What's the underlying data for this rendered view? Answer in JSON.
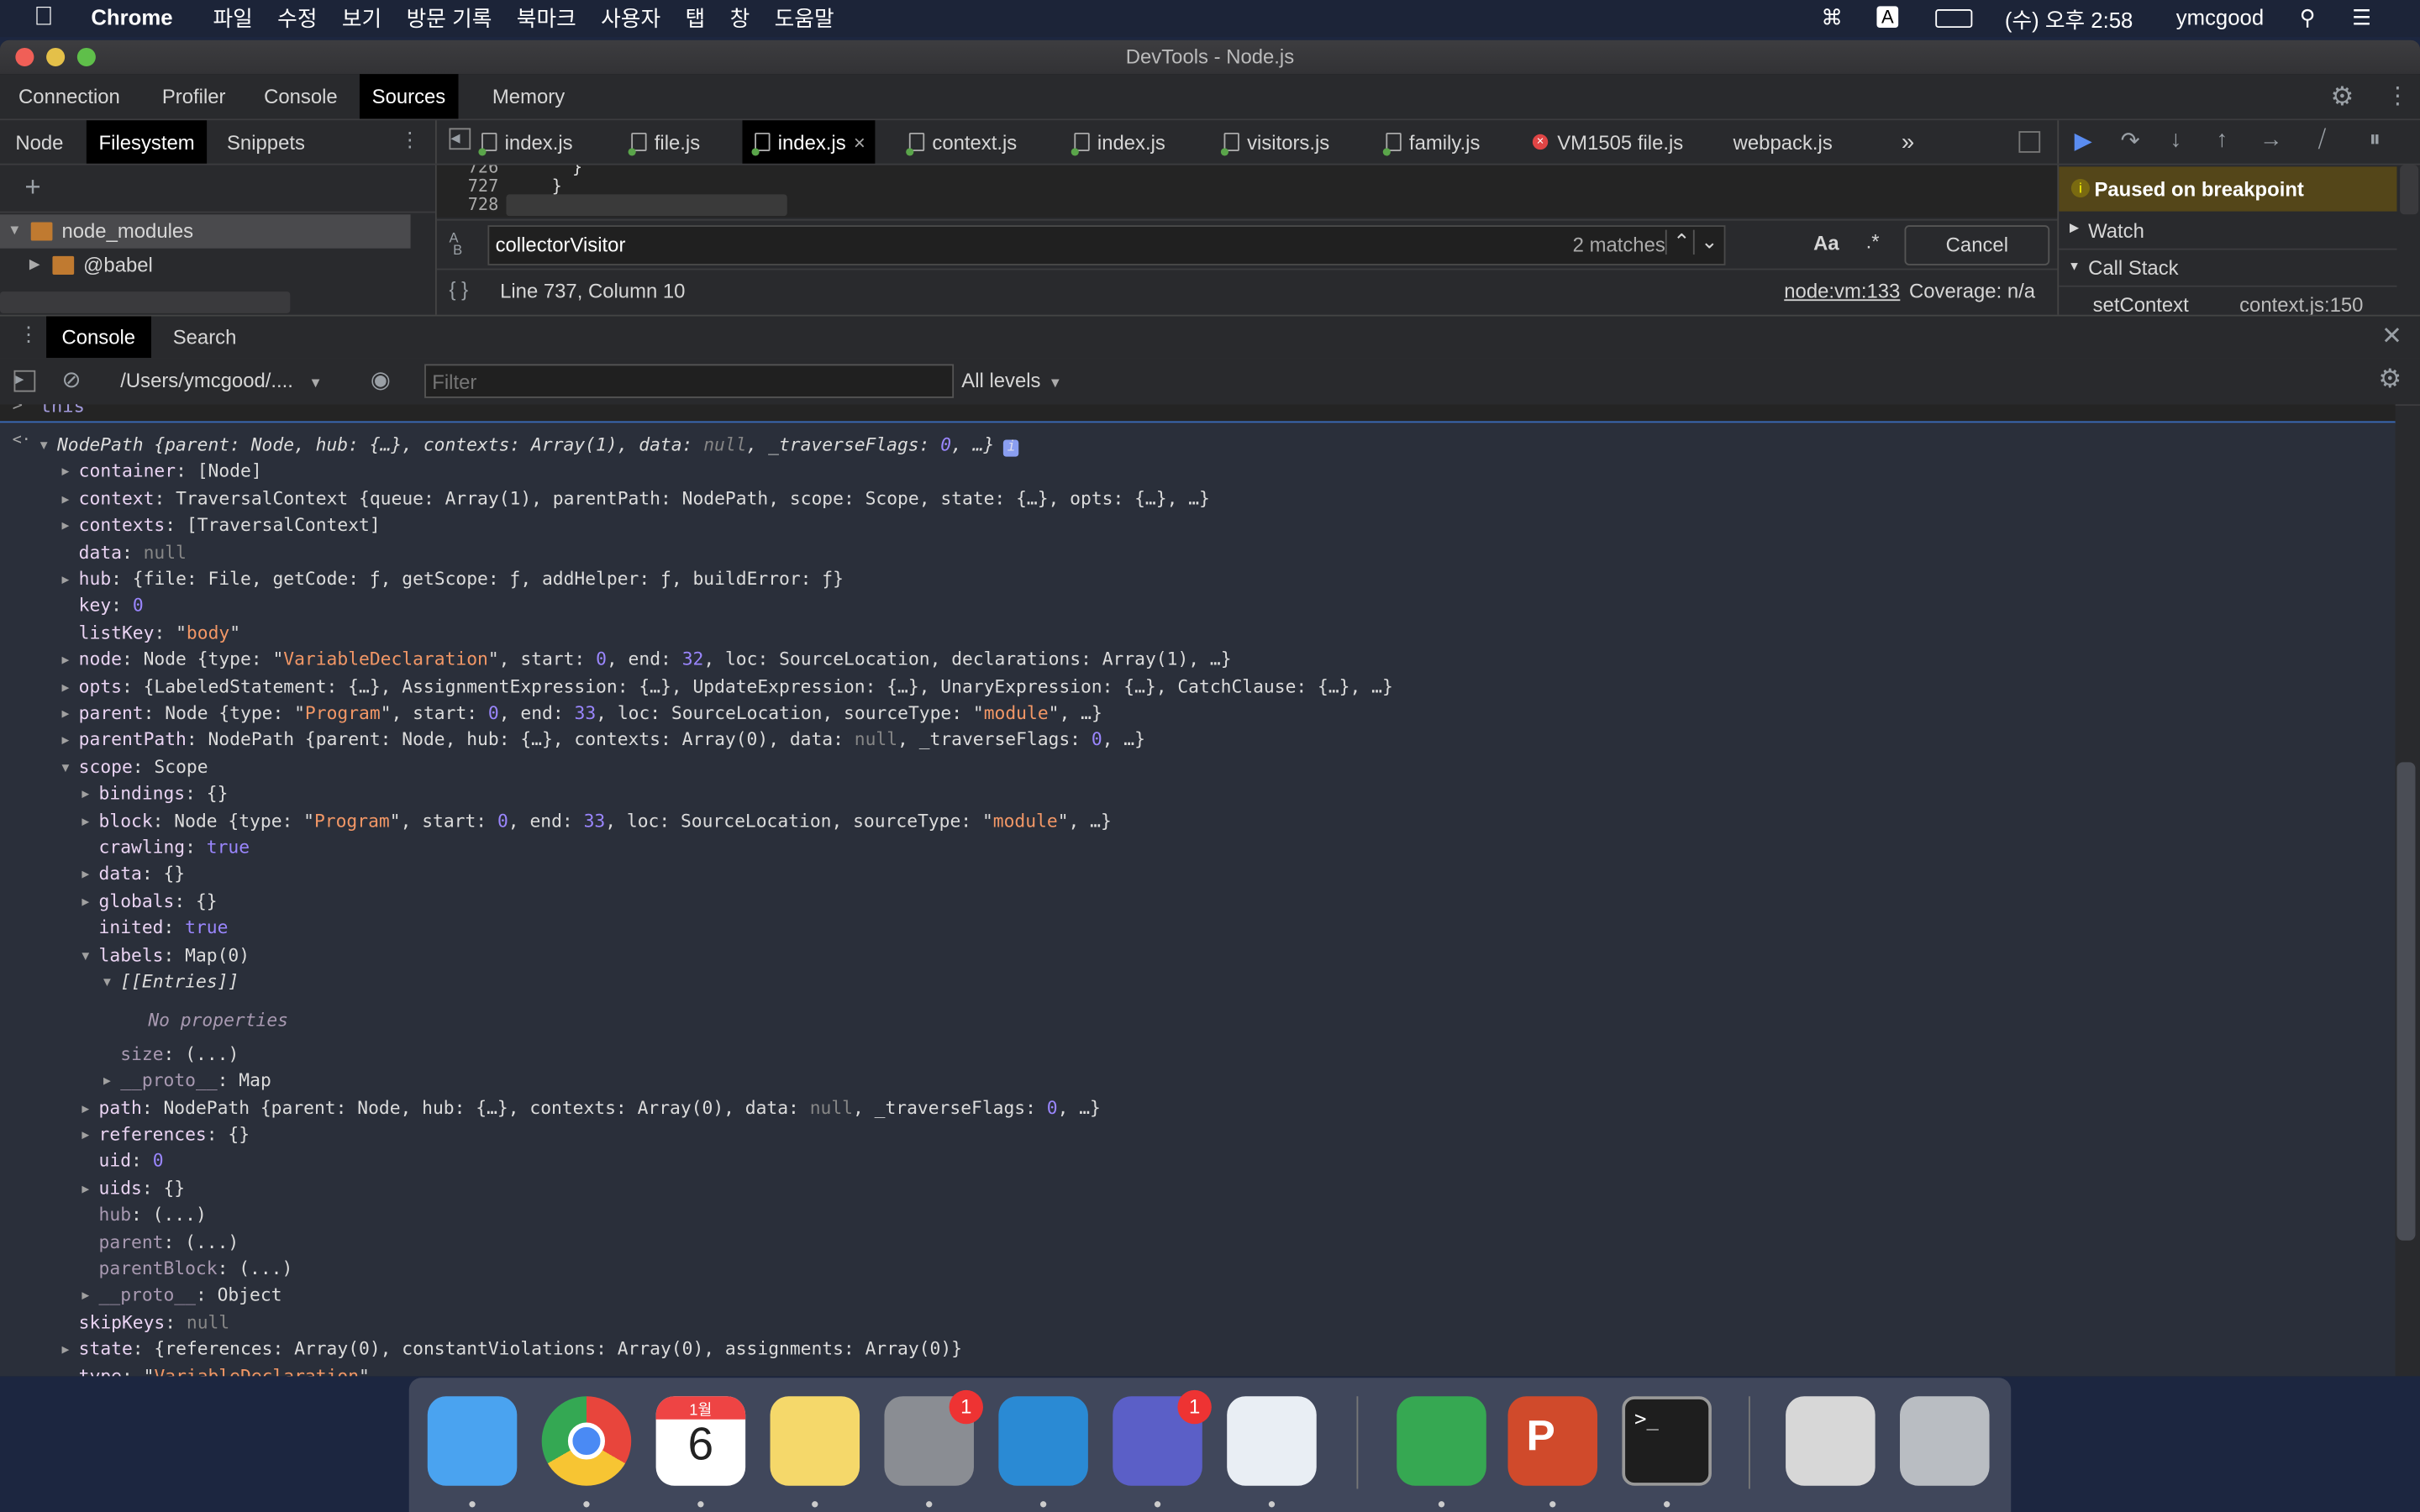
{
  "menubar": {
    "app": "Chrome",
    "menus": [
      "파일",
      "수정",
      "보기",
      "방문 기록",
      "북마크",
      "사용자",
      "탭",
      "창",
      "도움말"
    ],
    "input_source": "A",
    "clock": "(수) 오후 2:58",
    "user": "ymcgood"
  },
  "window": {
    "title": "DevTools - Node.js"
  },
  "main_tabs": [
    {
      "label": "Connection"
    },
    {
      "label": "Profiler"
    },
    {
      "label": "Console"
    },
    {
      "label": "Sources",
      "active": true
    },
    {
      "label": "Memory"
    }
  ],
  "navigator": {
    "tabs": [
      {
        "label": "Node"
      },
      {
        "label": "Filesystem",
        "active": true
      },
      {
        "label": "Snippets"
      }
    ],
    "add": "+",
    "tree": [
      {
        "label": "node_modules",
        "expanded": true,
        "selected": true
      },
      {
        "label": "@babel",
        "expanded": false
      }
    ]
  },
  "editor": {
    "tabs": [
      {
        "label": "index.js"
      },
      {
        "label": "file.js"
      },
      {
        "label": "index.js",
        "active": true,
        "close": "×"
      },
      {
        "label": "context.js"
      },
      {
        "label": "index.js"
      },
      {
        "label": "visitors.js"
      },
      {
        "label": "family.js"
      },
      {
        "label": "VM1505 file.js",
        "error": true
      },
      {
        "label": "webpack.js"
      }
    ],
    "more": "»",
    "line_numbers": [
      "726",
      "727",
      "728"
    ],
    "code_lines": [
      "      }",
      "    }",
      ""
    ],
    "search": {
      "value": "collectorVisitor",
      "matches": "2 matches",
      "case_label": "Aa",
      "regex_label": ".*",
      "cancel": "Cancel"
    },
    "status": {
      "position": "Line 737, Column 10",
      "source_link": "node:vm:133",
      "coverage": "Coverage: n/a"
    }
  },
  "debugger": {
    "paused": "Paused on breakpoint",
    "watch": "Watch",
    "call_stack": "Call Stack",
    "frames": [
      {
        "name": "setContext",
        "location": "context.js:150"
      }
    ],
    "paused_color": "#544619"
  },
  "drawer": {
    "tabs": [
      {
        "label": "Console",
        "active": true
      },
      {
        "label": "Search"
      }
    ],
    "context": "/Users/ymcgood/....",
    "filter_placeholder": "Filter",
    "levels": "All levels",
    "input_echo": "this"
  },
  "console_lines": [
    {
      "i": 0,
      "a": "d",
      "it": true,
      "v": [
        [
          "NodePath {parent: Node, hub: {…}, contexts: Array(1), data: ",
          "t"
        ],
        [
          "null",
          "nl"
        ],
        [
          ", _traverseFlags: ",
          "t"
        ],
        [
          "0",
          "n"
        ],
        [
          ", …}",
          "t"
        ]
      ],
      "badge": "i"
    },
    {
      "i": 1,
      "a": "r",
      "v": [
        [
          "container",
          "k"
        ],
        [
          ": [Node]",
          "t"
        ]
      ]
    },
    {
      "i": 1,
      "a": "r",
      "v": [
        [
          "context",
          "k"
        ],
        [
          ": TraversalContext {queue: Array(1), parentPath: NodePath, scope: Scope, state: {…}, opts: {…}, …}",
          "t"
        ]
      ]
    },
    {
      "i": 1,
      "a": "r",
      "v": [
        [
          "contexts",
          "k"
        ],
        [
          ": [TraversalContext]",
          "t"
        ]
      ]
    },
    {
      "i": 1,
      "v": [
        [
          "data",
          "k"
        ],
        [
          ": ",
          "t"
        ],
        [
          "null",
          "nl"
        ]
      ]
    },
    {
      "i": 1,
      "a": "r",
      "v": [
        [
          "hub",
          "k"
        ],
        [
          ": {file: File, getCode: ƒ, getScope: ƒ, addHelper: ƒ, buildError: ƒ}",
          "t"
        ]
      ]
    },
    {
      "i": 1,
      "v": [
        [
          "key",
          "k"
        ],
        [
          ": ",
          "t"
        ],
        [
          "0",
          "n"
        ]
      ]
    },
    {
      "i": 1,
      "v": [
        [
          "listKey",
          "k"
        ],
        [
          ": \"",
          "t"
        ],
        [
          "body",
          "s"
        ],
        [
          "\"",
          "t"
        ]
      ]
    },
    {
      "i": 1,
      "a": "r",
      "v": [
        [
          "node",
          "k"
        ],
        [
          ": Node {type: \"",
          "t"
        ],
        [
          "VariableDeclaration",
          "s"
        ],
        [
          "\", start: ",
          "t"
        ],
        [
          "0",
          "n"
        ],
        [
          ", end: ",
          "t"
        ],
        [
          "32",
          "n"
        ],
        [
          ", loc: SourceLocation, declarations: Array(1), …}",
          "t"
        ]
      ]
    },
    {
      "i": 1,
      "a": "r",
      "v": [
        [
          "opts",
          "k"
        ],
        [
          ": {LabeledStatement: {…}, AssignmentExpression: {…}, UpdateExpression: {…}, UnaryExpression: {…}, CatchClause: {…}, …}",
          "t"
        ]
      ]
    },
    {
      "i": 1,
      "a": "r",
      "v": [
        [
          "parent",
          "k"
        ],
        [
          ": Node {type: \"",
          "t"
        ],
        [
          "Program",
          "s"
        ],
        [
          "\", start: ",
          "t"
        ],
        [
          "0",
          "n"
        ],
        [
          ", end: ",
          "t"
        ],
        [
          "33",
          "n"
        ],
        [
          ", loc: SourceLocation, sourceType: \"",
          "t"
        ],
        [
          "module",
          "s"
        ],
        [
          "\", …}",
          "t"
        ]
      ]
    },
    {
      "i": 1,
      "a": "r",
      "v": [
        [
          "parentPath",
          "k"
        ],
        [
          ": NodePath {parent: Node, hub: {…}, contexts: Array(0), data: ",
          "t"
        ],
        [
          "null",
          "nl"
        ],
        [
          ", _traverseFlags: ",
          "t"
        ],
        [
          "0",
          "n"
        ],
        [
          ", …}",
          "t"
        ]
      ]
    },
    {
      "i": 1,
      "a": "d",
      "v": [
        [
          "scope",
          "k"
        ],
        [
          ": Scope",
          "t"
        ]
      ]
    },
    {
      "i": 2,
      "a": "r",
      "v": [
        [
          "bindings",
          "k"
        ],
        [
          ": {}",
          "t"
        ]
      ]
    },
    {
      "i": 2,
      "a": "r",
      "v": [
        [
          "block",
          "k"
        ],
        [
          ": Node {type: \"",
          "t"
        ],
        [
          "Program",
          "s"
        ],
        [
          "\", start: ",
          "t"
        ],
        [
          "0",
          "n"
        ],
        [
          ", end: ",
          "t"
        ],
        [
          "33",
          "n"
        ],
        [
          ", loc: SourceLocation, sourceType: \"",
          "t"
        ],
        [
          "module",
          "s"
        ],
        [
          "\", …}",
          "t"
        ]
      ]
    },
    {
      "i": 2,
      "v": [
        [
          "crawling",
          "k"
        ],
        [
          ": ",
          "t"
        ],
        [
          "true",
          "n"
        ]
      ]
    },
    {
      "i": 2,
      "a": "r",
      "v": [
        [
          "data",
          "k"
        ],
        [
          ": {}",
          "t"
        ]
      ]
    },
    {
      "i": 2,
      "a": "r",
      "v": [
        [
          "globals",
          "k"
        ],
        [
          ": {}",
          "t"
        ]
      ]
    },
    {
      "i": 2,
      "v": [
        [
          "inited",
          "k"
        ],
        [
          ": ",
          "t"
        ],
        [
          "true",
          "n"
        ]
      ]
    },
    {
      "i": 2,
      "a": "d",
      "v": [
        [
          "labels",
          "k"
        ],
        [
          ": Map(0)",
          "t"
        ]
      ]
    },
    {
      "i": 3,
      "a": "d",
      "it": true,
      "v": [
        [
          "[[Entries]]",
          "t"
        ]
      ]
    },
    {
      "i": 4,
      "it": true,
      "v": [
        [
          "No properties",
          "kd"
        ]
      ]
    },
    {
      "i": 3,
      "v": [
        [
          "size",
          "kd"
        ],
        [
          ": (...)",
          "t"
        ]
      ]
    },
    {
      "i": 3,
      "a": "r",
      "v": [
        [
          "__proto__",
          "kd"
        ],
        [
          ": Map",
          "t"
        ]
      ]
    },
    {
      "i": 2,
      "a": "r",
      "v": [
        [
          "path",
          "k"
        ],
        [
          ": NodePath {parent: Node, hub: {…}, contexts: Array(0), data: ",
          "t"
        ],
        [
          "null",
          "nl"
        ],
        [
          ", _traverseFlags: ",
          "t"
        ],
        [
          "0",
          "n"
        ],
        [
          ", …}",
          "t"
        ]
      ]
    },
    {
      "i": 2,
      "a": "r",
      "v": [
        [
          "references",
          "k"
        ],
        [
          ": {}",
          "t"
        ]
      ]
    },
    {
      "i": 2,
      "v": [
        [
          "uid",
          "k"
        ],
        [
          ": ",
          "t"
        ],
        [
          "0",
          "n"
        ]
      ]
    },
    {
      "i": 2,
      "a": "r",
      "v": [
        [
          "uids",
          "k"
        ],
        [
          ": {}",
          "t"
        ]
      ]
    },
    {
      "i": 2,
      "v": [
        [
          "hub",
          "kd"
        ],
        [
          ": (...)",
          "t"
        ]
      ]
    },
    {
      "i": 2,
      "v": [
        [
          "parent",
          "kd"
        ],
        [
          ": (...)",
          "t"
        ]
      ]
    },
    {
      "i": 2,
      "v": [
        [
          "parentBlock",
          "kd"
        ],
        [
          ": (...)",
          "t"
        ]
      ]
    },
    {
      "i": 2,
      "a": "r",
      "v": [
        [
          "__proto__",
          "kd"
        ],
        [
          ": Object",
          "t"
        ]
      ]
    },
    {
      "i": 1,
      "v": [
        [
          "skipKeys",
          "k"
        ],
        [
          ": ",
          "t"
        ],
        [
          "null",
          "nl"
        ]
      ]
    },
    {
      "i": 1,
      "a": "r",
      "v": [
        [
          "state",
          "k"
        ],
        [
          ": {references: Array(0), constantViolations: Array(0), assignments: Array(0)}",
          "t"
        ]
      ]
    },
    {
      "i": 1,
      "v": [
        [
          "type",
          "k"
        ],
        [
          ": \"",
          "t"
        ],
        [
          "VariableDeclaration",
          "s"
        ],
        [
          "\"",
          "t"
        ]
      ]
    }
  ],
  "dock": [
    {
      "name": "finder",
      "color": "#4aa3f0"
    },
    {
      "name": "chrome",
      "color": "#e8453c"
    },
    {
      "name": "calendar",
      "color": "#ffffff",
      "month": "1월",
      "day": "6"
    },
    {
      "name": "notes",
      "color": "#f5d86a"
    },
    {
      "name": "system-preferences",
      "color": "#8a8d93",
      "badge": "1"
    },
    {
      "name": "vscode",
      "color": "#2a8ad4"
    },
    {
      "name": "teams",
      "color": "#5b5fc7",
      "badge": "1"
    },
    {
      "name": "pitcher-app",
      "color": "#e9eef4"
    },
    {
      "name": "sourcetree",
      "color": "#36a852"
    },
    {
      "name": "powerpoint",
      "color": "#d04a2b",
      "letter": "P"
    },
    {
      "name": "terminal",
      "color": "#1e1e1e",
      "prompt": ">_"
    },
    {
      "name": "documents-stack",
      "color": "#d7d7d7"
    },
    {
      "name": "trash",
      "color": "#b9bdc2"
    }
  ]
}
